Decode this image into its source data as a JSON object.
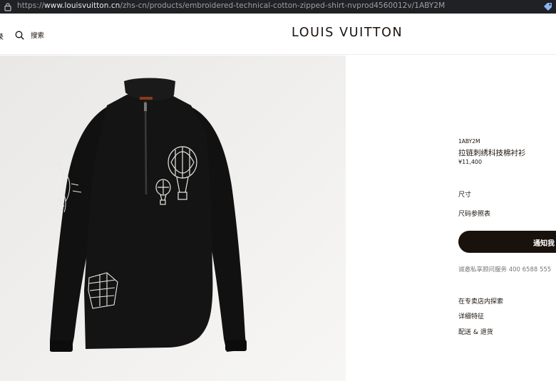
{
  "browser": {
    "url_prefix": "https://",
    "url_host": "www.louisvuitton.cn",
    "url_path": "/zhs-cn/products/embroidered-technical-cotton-zipped-shirt-nvprod4560012v/1ABY2M",
    "icons": {
      "lock": "lock-icon",
      "tag": "tag-icon"
    }
  },
  "header": {
    "menu_partial": "录",
    "search_label": "搜索",
    "logo": "LOUIS VUITTON"
  },
  "product": {
    "sku": "1ABY2M",
    "title": "拉链刺绣科技棉衬衫",
    "price": "¥11,400",
    "size_label": "尺寸",
    "size_guide": "尺码参照表",
    "button_label": "通知我",
    "service_text": "诚邀私享顾问服务 400 6588 555",
    "links": [
      "在专卖店内探索",
      "详细特征",
      "配送 & 退货"
    ]
  },
  "colors": {
    "brand_dark": "#19110b",
    "image_bg": "#f3f2f1",
    "browser_bar": "#202124"
  }
}
